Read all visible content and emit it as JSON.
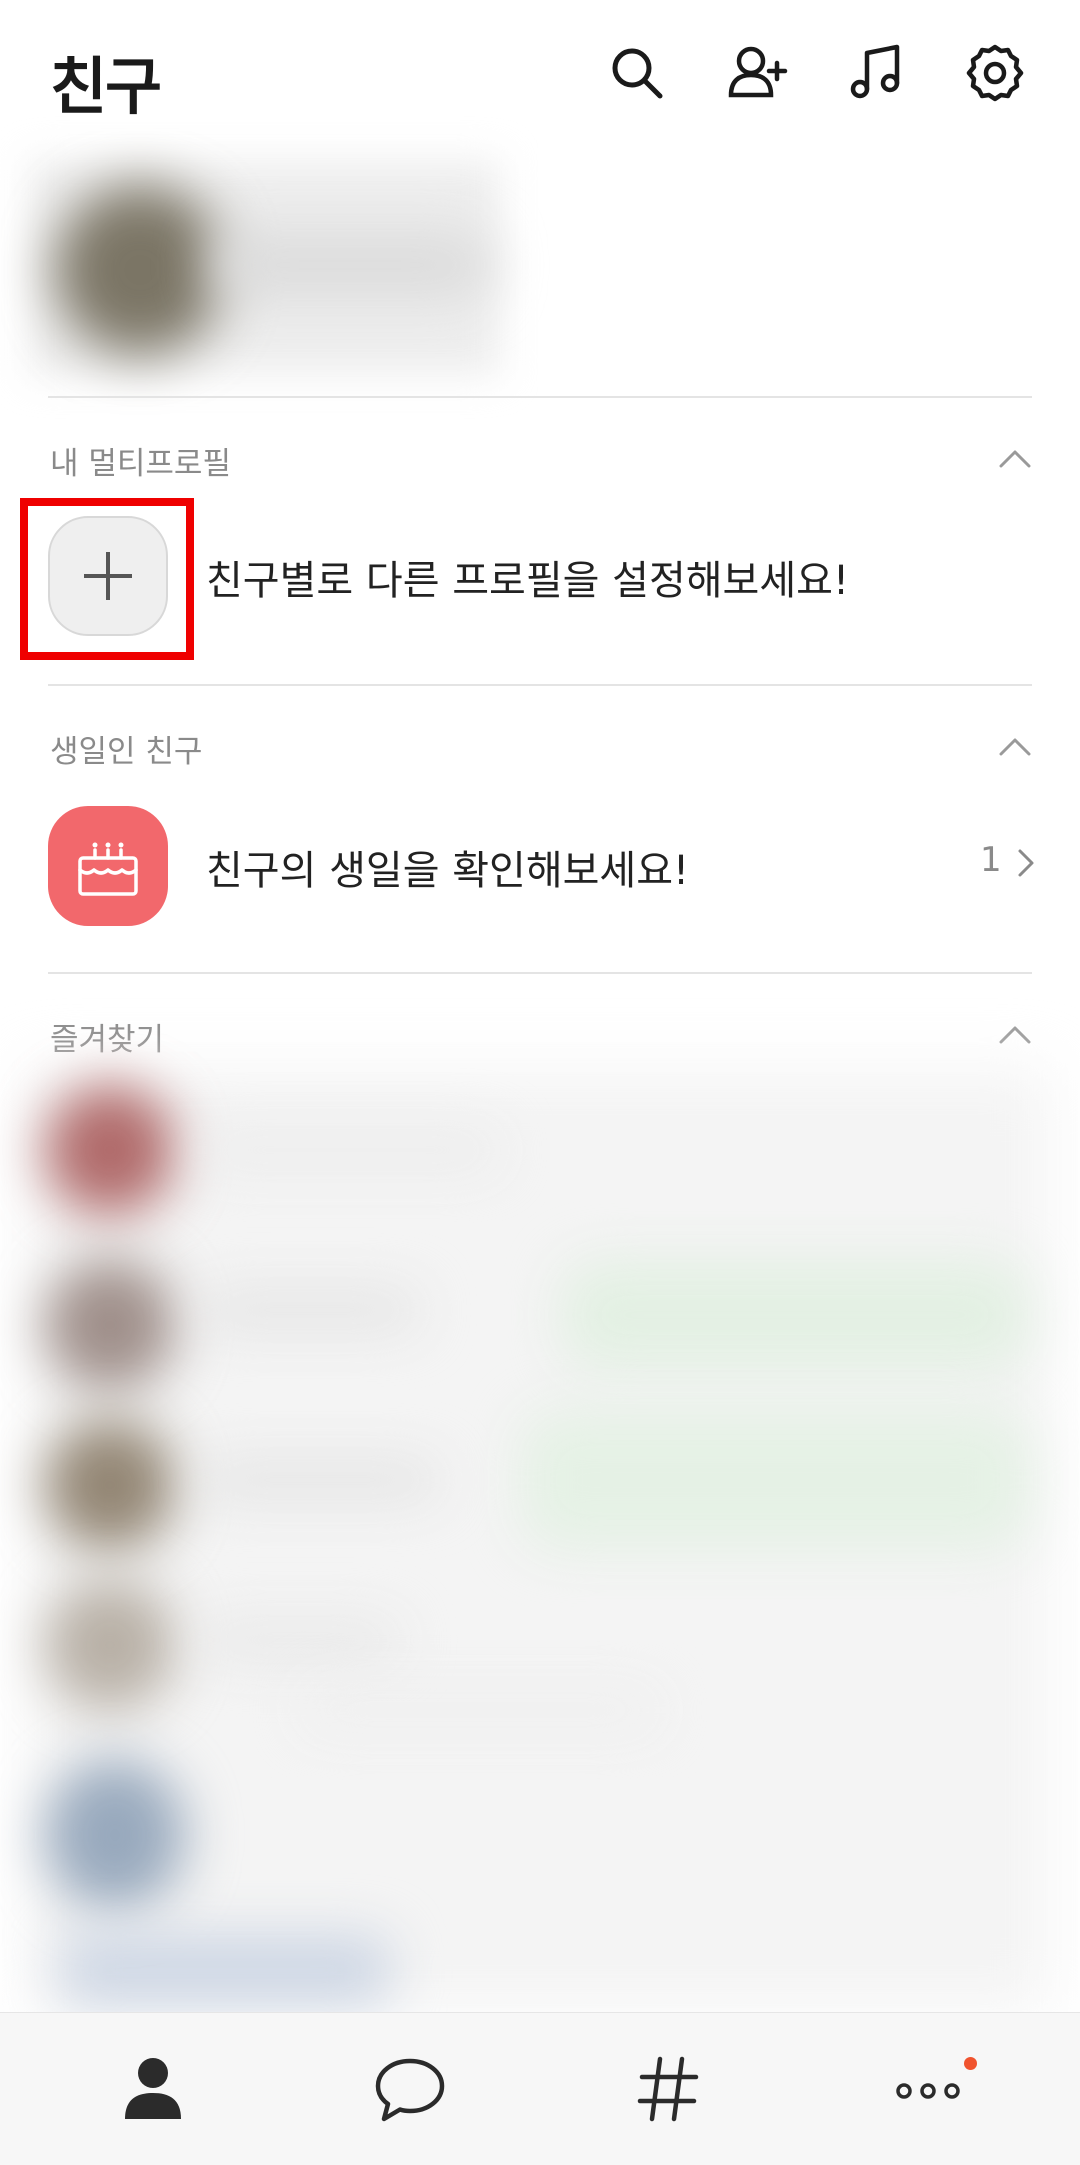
{
  "header": {
    "title": "친구",
    "icons": [
      "search-icon",
      "add-friend-icon",
      "music-icon",
      "settings-icon"
    ]
  },
  "multi_profile": {
    "label": "내 멀티프로필",
    "prompt": "친구별로 다른 프로필을 설정해보세요!"
  },
  "birthday": {
    "label": "생일인 친구",
    "prompt": "친구의 생일을 확인해보세요!",
    "count": "1"
  },
  "favorites": {
    "label": "즐겨찾기"
  },
  "bottom_nav": {
    "items": [
      "friends-tab",
      "chats-tab",
      "hashtag-tab",
      "more-tab"
    ],
    "active": "friends-tab"
  },
  "colors": {
    "birthday_tile": "#f2686c",
    "highlight_box": "#ef0000",
    "notification_dot": "#f0532e"
  }
}
